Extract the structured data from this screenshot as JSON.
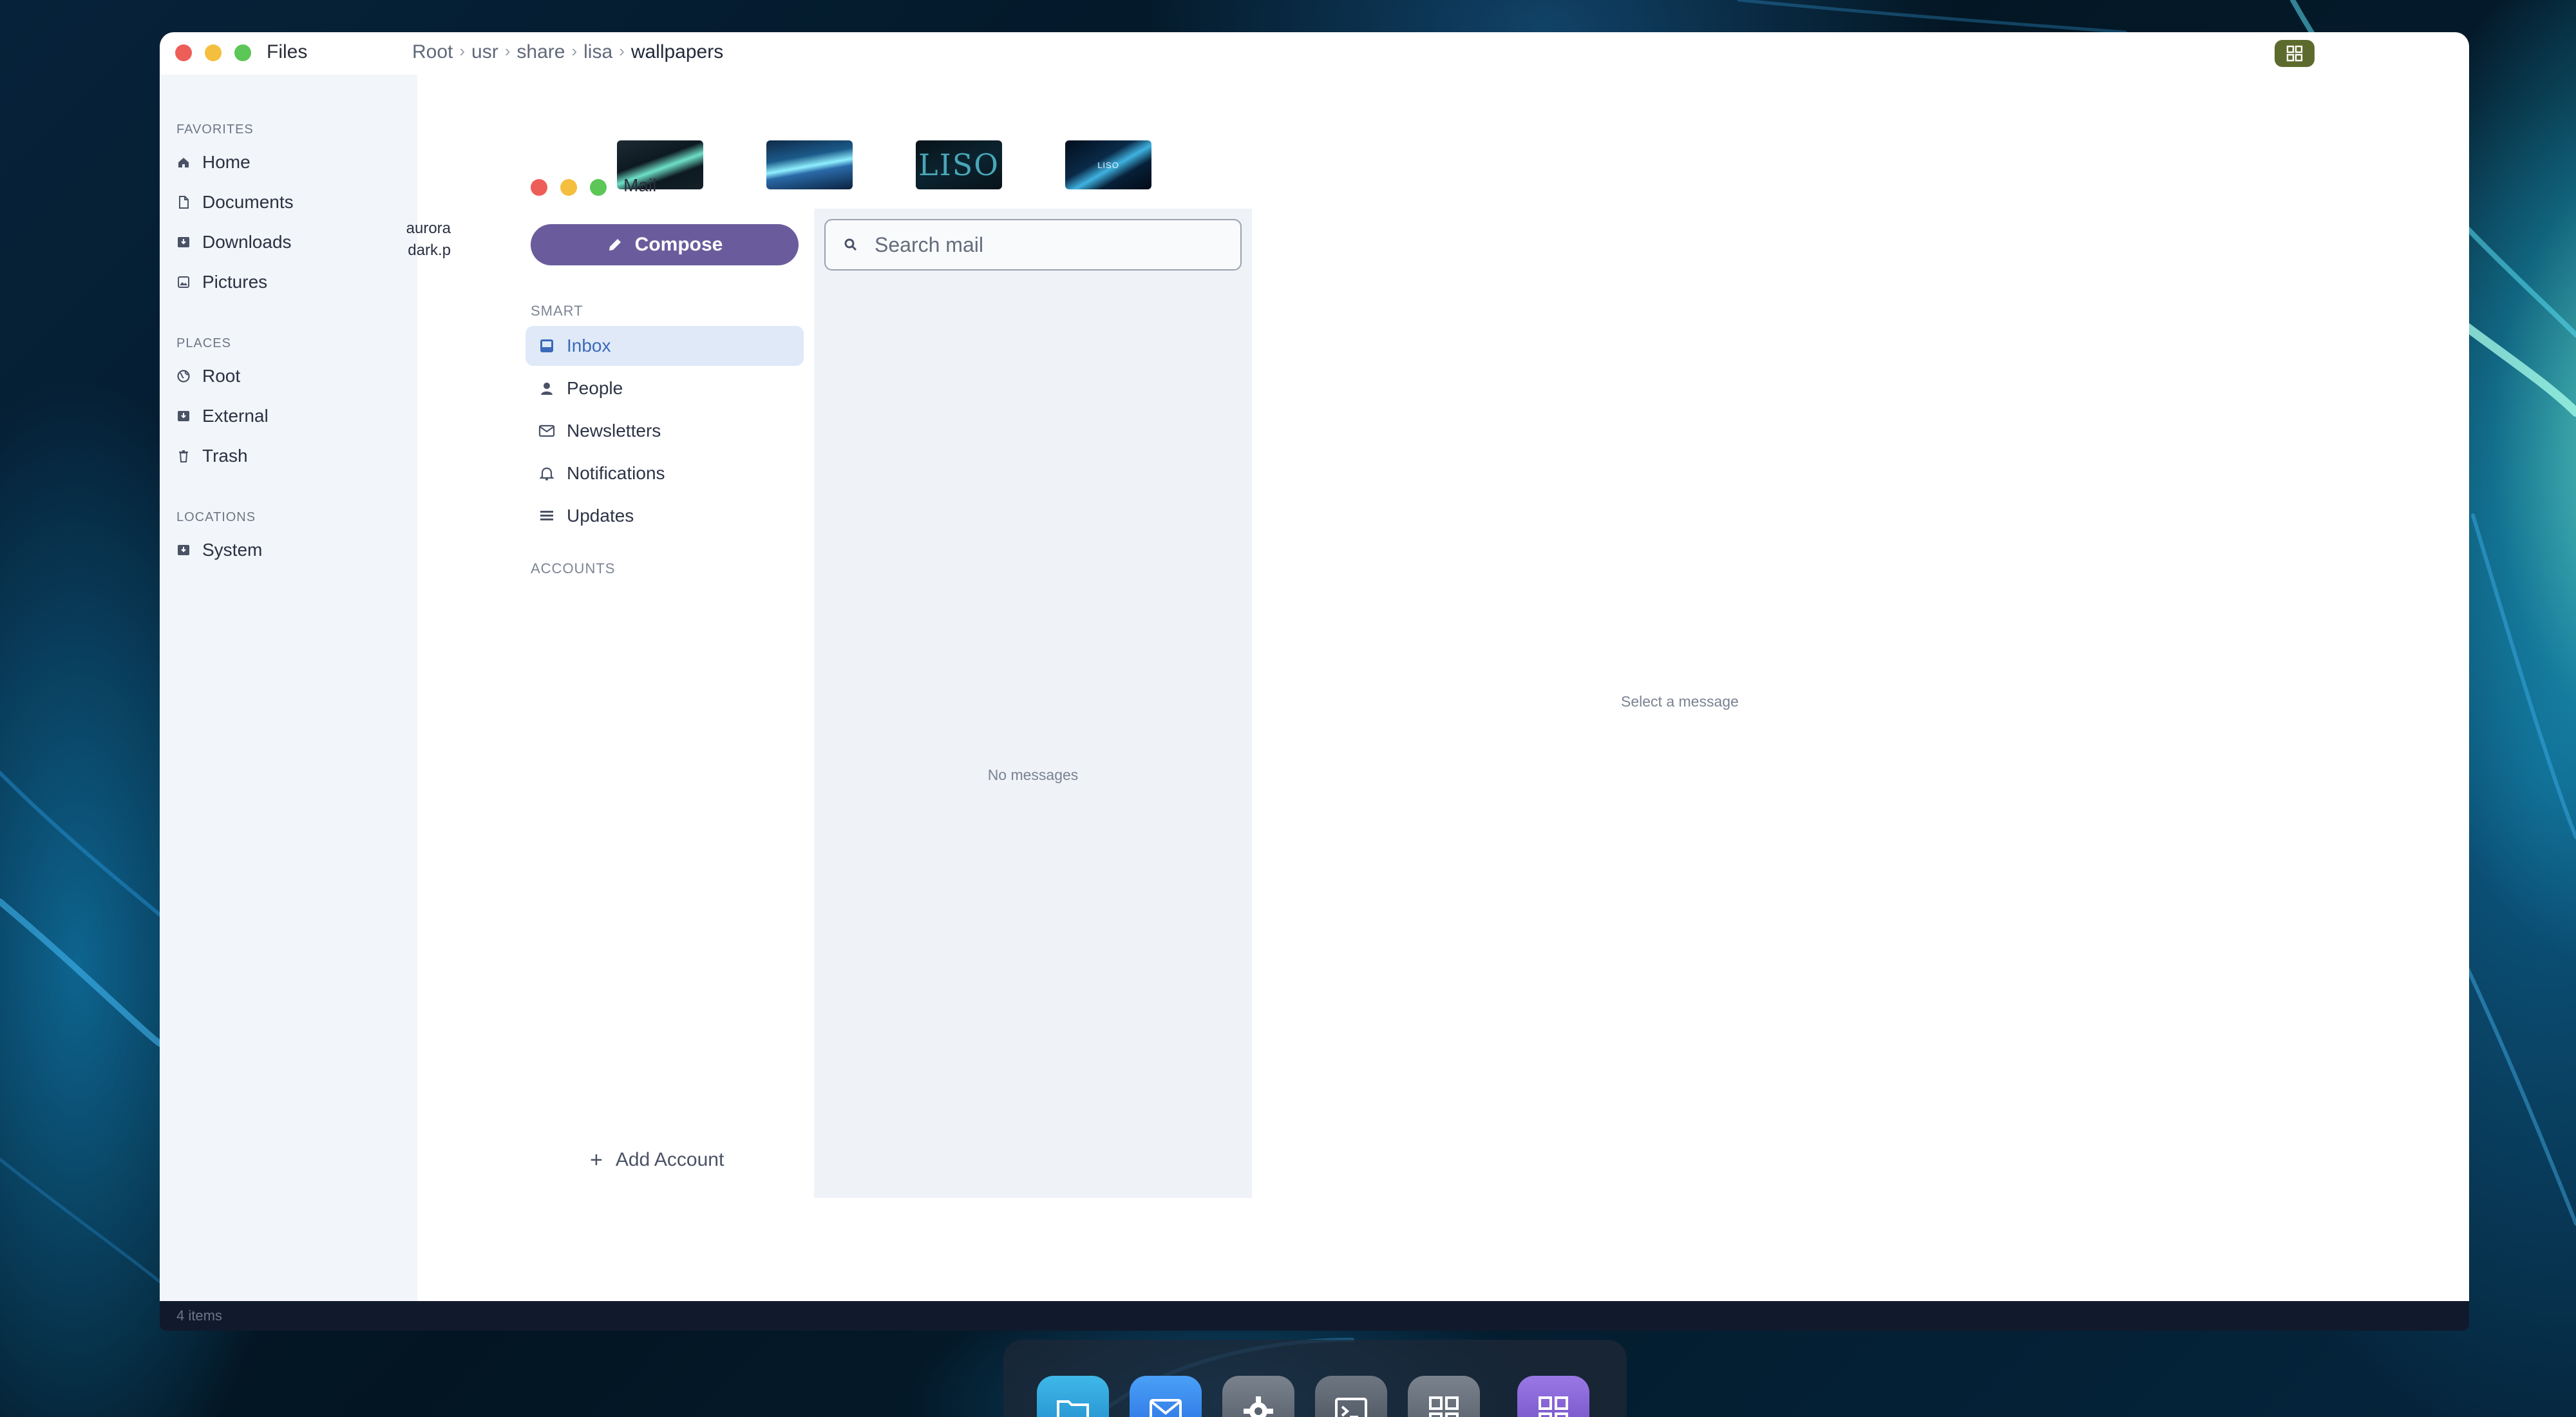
{
  "files": {
    "title": "Files",
    "breadcrumb": [
      "Root",
      "usr",
      "share",
      "lisa",
      "wallpapers"
    ],
    "sidebar": {
      "favorites_label": "FAVORITES",
      "favorites": [
        {
          "label": "Home",
          "icon": "home-icon"
        },
        {
          "label": "Documents",
          "icon": "document-icon"
        },
        {
          "label": "Downloads",
          "icon": "download-icon"
        },
        {
          "label": "Pictures",
          "icon": "picture-icon"
        }
      ],
      "places_label": "PLACES",
      "places": [
        {
          "label": "Root",
          "icon": "globe-icon"
        },
        {
          "label": "External",
          "icon": "drive-icon"
        },
        {
          "label": "Trash",
          "icon": "trash-icon"
        }
      ],
      "locations_label": "LOCATIONS",
      "locations": [
        {
          "label": "System",
          "icon": "drive-icon"
        }
      ]
    },
    "thumbnails": [
      {
        "name": "aurora dark thumbnail"
      },
      {
        "name": "aurora light thumbnail"
      },
      {
        "name": "lisa logo thumbnail",
        "text": "LISO"
      },
      {
        "name": "lisa small thumbnail",
        "text": "LISO"
      }
    ],
    "file_label_line1": "aurora",
    "file_label_line2": "dark.p",
    "status": "4 items"
  },
  "mail": {
    "title": "Mail",
    "compose_label": "Compose",
    "smart_label": "SMART",
    "nav": [
      {
        "label": "Inbox",
        "icon": "inbox-icon",
        "active": true
      },
      {
        "label": "People",
        "icon": "person-icon"
      },
      {
        "label": "Newsletters",
        "icon": "envelope-icon"
      },
      {
        "label": "Notifications",
        "icon": "bell-icon"
      },
      {
        "label": "Updates",
        "icon": "list-icon"
      }
    ],
    "accounts_label": "ACCOUNTS",
    "add_account_label": "Add Account",
    "search_placeholder": "Search mail",
    "empty_list": "No messages",
    "empty_reader": "Select a message"
  },
  "dock": [
    {
      "name": "files-app",
      "icon": "folder-icon"
    },
    {
      "name": "mail-app",
      "icon": "envelope-icon"
    },
    {
      "name": "settings-app",
      "icon": "gear-icon"
    },
    {
      "name": "terminal-app",
      "icon": "terminal-icon"
    },
    {
      "name": "grid-app",
      "icon": "grid-icon"
    },
    {
      "name": "apps-launcher",
      "icon": "apps-icon"
    }
  ],
  "colors": {
    "accent": "#6a5c9c",
    "selection": "#dfe9f8",
    "sidebar_bg": "#f2f5f9",
    "view_toggle": "#5d6a2e"
  }
}
